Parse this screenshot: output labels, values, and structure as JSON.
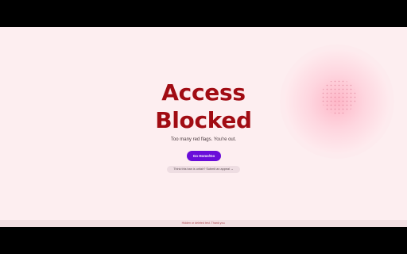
{
  "page": {
    "title_line_1": "Access",
    "title_line_2": "Blocked",
    "subtitle": "Too many red flags. You're out.",
    "primary_button_label": "Go Home/Go",
    "appeal_text": "Think this ban is unfair? Submit an appeal →",
    "footer_text": "Hidden or deleted test. Thank you."
  },
  "colors": {
    "background": "#fdeef0",
    "title": "#a10c13",
    "primary_button": "#6a0dd9",
    "appeal_chip": "#eedde2",
    "footer_text": "#b0474f"
  }
}
